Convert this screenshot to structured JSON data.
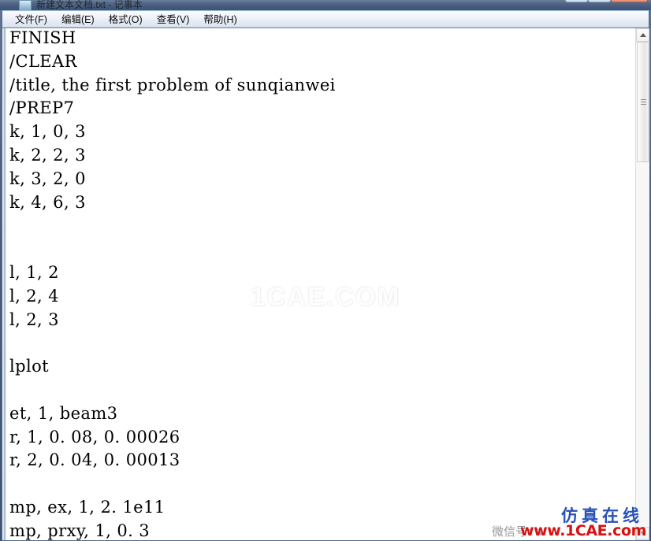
{
  "window": {
    "title": "新建文本文档.txt - 记事本",
    "controls": {
      "minimize": "—",
      "maximize": "❐",
      "close": "✕"
    }
  },
  "menubar": {
    "items": [
      {
        "label": "文件(F)",
        "name": "menu-file"
      },
      {
        "label": "编辑(E)",
        "name": "menu-edit"
      },
      {
        "label": "格式(O)",
        "name": "menu-format"
      },
      {
        "label": "查看(V)",
        "name": "menu-view"
      },
      {
        "label": "帮助(H)",
        "name": "menu-help"
      }
    ]
  },
  "editor": {
    "content": "FINISH\n/CLEAR\n/title, the first problem of sunqianwei\n/PREP7\nk, 1, 0, 3\nk, 2, 2, 3\nk, 3, 2, 0\nk, 4, 6, 3\n\n\nl, 1, 2\nl, 2, 4\nl, 2, 3\n\nlplot\n\net, 1, beam3\nr, 1, 0. 08, 0. 00026\nr, 2, 0. 04, 0. 00013\n\nmp, ex, 1, 2. 1e11\nmp, prxy, 1, 0. 3",
    "lines": [
      "FINISH",
      "/CLEAR",
      "/title, the first problem of sunqianwei",
      "/PREP7",
      "k, 1, 0, 3",
      "k, 2, 2, 3",
      "k, 3, 2, 0",
      "k, 4, 6, 3",
      "",
      "",
      "l, 1, 2",
      "l, 2, 4",
      "l, 2, 3",
      "",
      "lplot",
      "",
      "et, 1, beam3",
      "r, 1, 0. 08, 0. 00026",
      "r, 2, 0. 04, 0. 00013",
      "",
      "mp, ex, 1, 2. 1e11",
      "mp, prxy, 1, 0. 3"
    ]
  },
  "scrollbar": {
    "up_arrow": "▲",
    "down_arrow": "▼"
  },
  "watermarks": {
    "center": "1CAE.COM",
    "brand_cn": "仿真在线",
    "brand_url": "www.1CAE.com",
    "wechat": "微信号: a"
  },
  "colors": {
    "brand_blue": "#2852b8",
    "brand_red": "#d81010",
    "titlebar": "#4a6183",
    "menubar": "#eef1f9",
    "editor_bg": "#ffffff",
    "text": "#000000"
  }
}
